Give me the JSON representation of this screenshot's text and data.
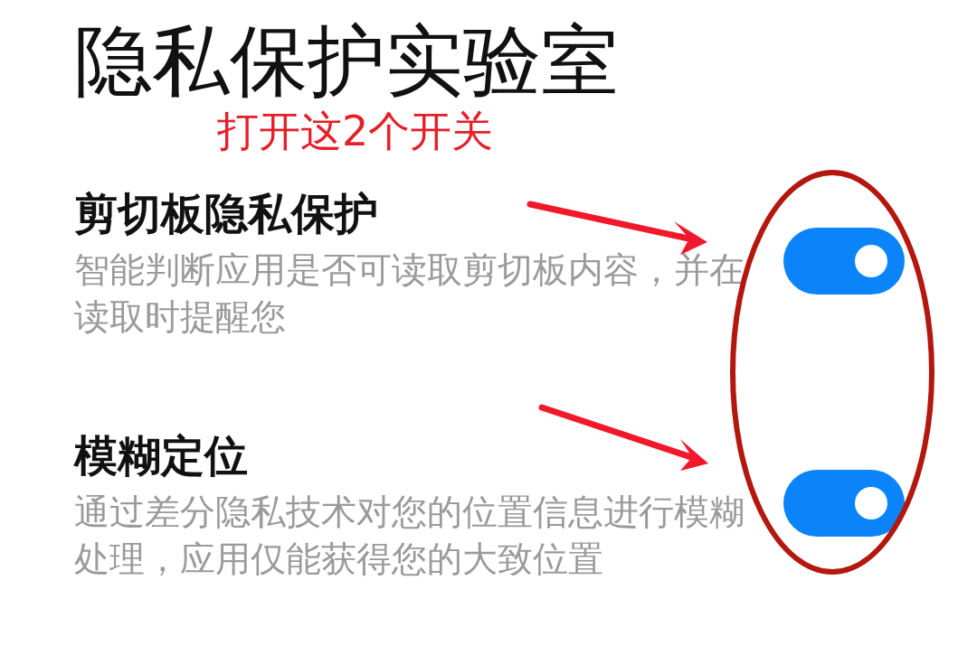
{
  "title": "隐私保护实验室",
  "annotation": "打开这2个开关",
  "settings": [
    {
      "title": "剪切板隐私保护",
      "description": "智能判断应用是否可读取剪切板内容，并在读取时提醒您",
      "on": true
    },
    {
      "title": "模糊定位",
      "description": "通过差分隐私技术对您的位置信息进行模糊处理，应用仅能获得您的大致位置",
      "on": true
    }
  ]
}
